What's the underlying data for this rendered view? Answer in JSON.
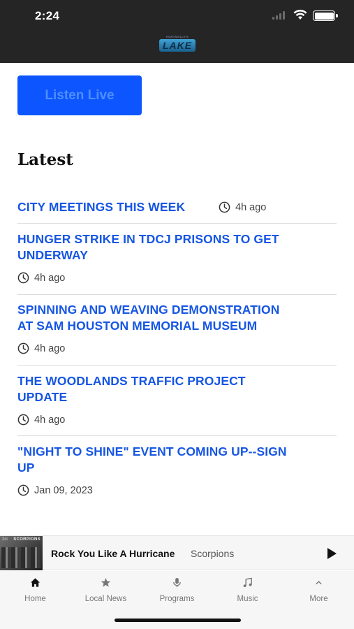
{
  "status_bar": {
    "time": "2:24"
  },
  "header": {
    "logo_small_text": "HUNTSVILLE'S",
    "logo_text": "LAKE"
  },
  "listen_button": {
    "label": "Listen Live"
  },
  "section_title": "Latest",
  "articles": [
    {
      "title": "CITY MEETINGS THIS WEEK",
      "time": "4h ago"
    },
    {
      "title_lines": [
        "HUNGER STRIKE IN TDCJ PRISONS TO GET",
        "UNDERWAY"
      ],
      "time": "4h ago"
    },
    {
      "title_lines": [
        "SPINNING AND WEAVING DEMONSTRATION",
        "AT SAM HOUSTON MEMORIAL MUSEUM"
      ],
      "time": "4h ago"
    },
    {
      "title_lines": [
        "THE WOODLANDS TRAFFIC PROJECT",
        "UPDATE"
      ],
      "time": "4h ago"
    },
    {
      "title_lines": [
        "\"NIGHT TO SHINE\" EVENT COMING UP--SIGN",
        "UP"
      ],
      "time": "Jan 09, 2023"
    }
  ],
  "now_playing": {
    "track": "Rock You Like A Hurricane",
    "artist": "Scorpions",
    "album_text": "SCORPIONS",
    "album_mark": "2ci"
  },
  "tabs": [
    {
      "label": "Home",
      "icon": "home-icon"
    },
    {
      "label": "Local News",
      "icon": "star-icon"
    },
    {
      "label": "Programs",
      "icon": "microphone-icon"
    },
    {
      "label": "Music",
      "icon": "music-note-icon"
    },
    {
      "label": "More",
      "icon": "chevron-up-icon"
    }
  ],
  "colors": {
    "accent": "#1656e4",
    "button": "#0d55ff",
    "status_bar": "#252525"
  }
}
